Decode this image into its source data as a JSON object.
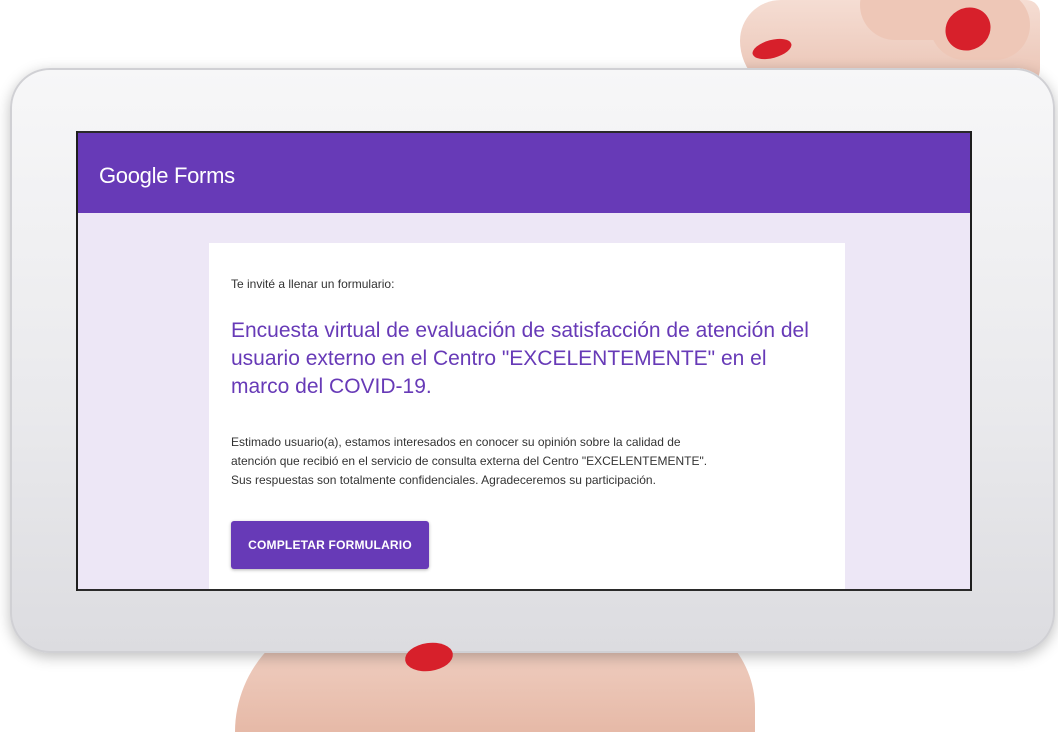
{
  "header": {
    "brand_google": "Google",
    "brand_forms": "Forms"
  },
  "card": {
    "intro": "Te invité a llenar un formulario:",
    "title": "Encuesta virtual de evaluación de satisfacción de atención del usuario externo en el Centro \"EXCELENTEMENTE\" en el marco del COVID-19.",
    "description_lines": [
      "Estimado usuario(a), estamos interesados en conocer su opinión sobre la calidad de",
      "atención que recibió en el servicio de consulta externa del Centro \"EXCELENTEMENTE\".",
      "Sus respuestas son totalmente confidenciales. Agradeceremos su participación."
    ],
    "cta_label": "COMPLETAR FORMULARIO"
  },
  "colors": {
    "primary": "#673ab7",
    "background": "#ede7f6",
    "nail": "#d7202b"
  }
}
